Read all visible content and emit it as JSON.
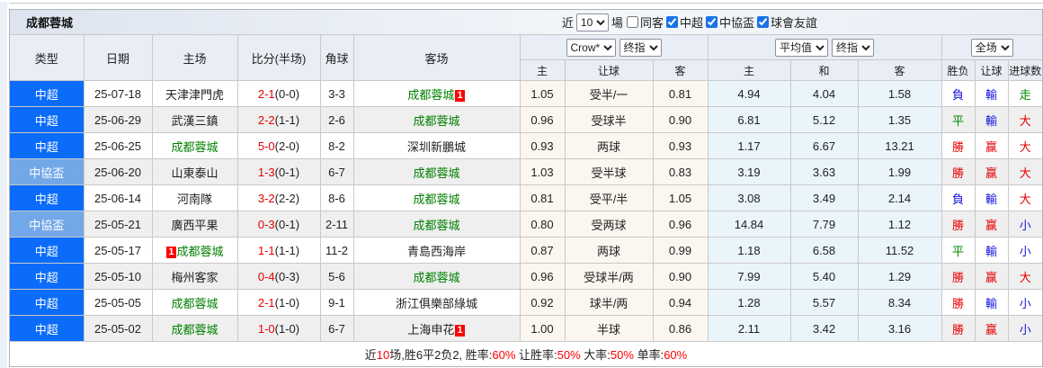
{
  "colors": {
    "league_type": {
      "中超": "#0b6cfa",
      "中協盃": "#73a8e8"
    },
    "result": {
      "勝": "#e60000",
      "赢": "#e60000",
      "大": "#e60000",
      "平": "#008800",
      "走": "#008800",
      "負": "#1515dd",
      "輸": "#1515dd",
      "小": "#1515dd"
    },
    "self_team": "#008000",
    "score": "#e60000",
    "badge_bg": "#ff0000",
    "stat_red": "#ff0000"
  },
  "toolbar": {
    "title": "成都蓉城",
    "recent_prefix": "近",
    "recent_value": "10",
    "recent_suffix": "場",
    "filters": [
      {
        "label": "同客",
        "checked": false
      },
      {
        "label": "中超",
        "checked": true
      },
      {
        "label": "中協盃",
        "checked": true
      },
      {
        "label": "球會友誼",
        "checked": true
      }
    ]
  },
  "columns": {
    "type": "类型",
    "date": "日期",
    "home": "主场",
    "score": "比分(半场)",
    "corner": "角球",
    "away": "客场",
    "sub": [
      "主",
      "让球",
      "客",
      "主",
      "和",
      "客",
      "胜负",
      "让球",
      "进球数"
    ]
  },
  "selects": {
    "asian_source": "Crow*",
    "asian_time": "终指",
    "euro_source": "平均值",
    "euro_time": "终指",
    "scope": "全场"
  },
  "rows": [
    {
      "type": "中超",
      "date": "25-07-18",
      "home": {
        "name": "天津津門虎",
        "self": false,
        "badge": ""
      },
      "away": {
        "name": "成都蓉城",
        "self": true,
        "badge": "1",
        "badge_side": "right"
      },
      "ft": "2-1",
      "ht": "(0-0)",
      "corner": "3-3",
      "hcap_home": "1.05",
      "hcap_line": "受半/一",
      "hcap_away": "0.81",
      "avg_home": "4.94",
      "avg_draw": "4.04",
      "avg_away": "1.58",
      "res_wdl": "負",
      "res_hcap": "輸",
      "res_goal": "走"
    },
    {
      "type": "中超",
      "date": "25-06-29",
      "home": {
        "name": "武漢三鎮",
        "self": false,
        "badge": ""
      },
      "away": {
        "name": "成都蓉城",
        "self": true,
        "badge": ""
      },
      "ft": "2-2",
      "ht": "(1-1)",
      "corner": "2-6",
      "hcap_home": "0.96",
      "hcap_line": "受球半",
      "hcap_away": "0.90",
      "avg_home": "6.81",
      "avg_draw": "5.12",
      "avg_away": "1.35",
      "res_wdl": "平",
      "res_hcap": "輸",
      "res_goal": "大"
    },
    {
      "type": "中超",
      "date": "25-06-25",
      "home": {
        "name": "成都蓉城",
        "self": true,
        "badge": ""
      },
      "away": {
        "name": "深圳新鵬城",
        "self": false,
        "badge": ""
      },
      "ft": "5-0",
      "ht": "(2-0)",
      "corner": "8-2",
      "hcap_home": "0.93",
      "hcap_line": "两球",
      "hcap_away": "0.93",
      "avg_home": "1.17",
      "avg_draw": "6.67",
      "avg_away": "13.21",
      "res_wdl": "勝",
      "res_hcap": "赢",
      "res_goal": "大"
    },
    {
      "type": "中協盃",
      "date": "25-06-20",
      "home": {
        "name": "山東泰山",
        "self": false,
        "badge": ""
      },
      "away": {
        "name": "成都蓉城",
        "self": true,
        "badge": ""
      },
      "ft": "1-3",
      "ht": "(0-1)",
      "corner": "6-7",
      "hcap_home": "1.03",
      "hcap_line": "受半球",
      "hcap_away": "0.83",
      "avg_home": "3.19",
      "avg_draw": "3.63",
      "avg_away": "1.99",
      "res_wdl": "勝",
      "res_hcap": "赢",
      "res_goal": "大"
    },
    {
      "type": "中超",
      "date": "25-06-14",
      "home": {
        "name": "河南隊",
        "self": false,
        "badge": ""
      },
      "away": {
        "name": "成都蓉城",
        "self": true,
        "badge": ""
      },
      "ft": "3-2",
      "ht": "(2-2)",
      "corner": "8-6",
      "hcap_home": "0.81",
      "hcap_line": "受平/半",
      "hcap_away": "1.05",
      "avg_home": "3.08",
      "avg_draw": "3.49",
      "avg_away": "2.14",
      "res_wdl": "負",
      "res_hcap": "輸",
      "res_goal": "大"
    },
    {
      "type": "中協盃",
      "date": "25-05-21",
      "home": {
        "name": "廣西平果",
        "self": false,
        "badge": ""
      },
      "away": {
        "name": "成都蓉城",
        "self": true,
        "badge": ""
      },
      "ft": "0-3",
      "ht": "(0-1)",
      "corner": "2-11",
      "hcap_home": "0.80",
      "hcap_line": "受两球",
      "hcap_away": "0.96",
      "avg_home": "14.84",
      "avg_draw": "7.79",
      "avg_away": "1.12",
      "res_wdl": "勝",
      "res_hcap": "赢",
      "res_goal": "小"
    },
    {
      "type": "中超",
      "date": "25-05-17",
      "home": {
        "name": "成都蓉城",
        "self": true,
        "badge": "1",
        "badge_side": "left"
      },
      "away": {
        "name": "青島西海岸",
        "self": false,
        "badge": ""
      },
      "ft": "1-1",
      "ht": "(1-1)",
      "corner": "11-2",
      "hcap_home": "0.87",
      "hcap_line": "两球",
      "hcap_away": "0.99",
      "avg_home": "1.18",
      "avg_draw": "6.58",
      "avg_away": "11.52",
      "res_wdl": "平",
      "res_hcap": "輸",
      "res_goal": "小"
    },
    {
      "type": "中超",
      "date": "25-05-10",
      "home": {
        "name": "梅州客家",
        "self": false,
        "badge": ""
      },
      "away": {
        "name": "成都蓉城",
        "self": true,
        "badge": ""
      },
      "ft": "0-4",
      "ht": "(0-3)",
      "corner": "5-6",
      "hcap_home": "0.96",
      "hcap_line": "受球半/两",
      "hcap_away": "0.90",
      "avg_home": "7.99",
      "avg_draw": "5.40",
      "avg_away": "1.29",
      "res_wdl": "勝",
      "res_hcap": "赢",
      "res_goal": "大"
    },
    {
      "type": "中超",
      "date": "25-05-05",
      "home": {
        "name": "成都蓉城",
        "self": true,
        "badge": ""
      },
      "away": {
        "name": "浙江俱樂部綠城",
        "self": false,
        "badge": ""
      },
      "ft": "2-1",
      "ht": "(1-0)",
      "corner": "9-1",
      "hcap_home": "0.92",
      "hcap_line": "球半/两",
      "hcap_away": "0.94",
      "avg_home": "1.28",
      "avg_draw": "5.57",
      "avg_away": "8.34",
      "res_wdl": "勝",
      "res_hcap": "輸",
      "res_goal": "小"
    },
    {
      "type": "中超",
      "date": "25-05-02",
      "home": {
        "name": "成都蓉城",
        "self": true,
        "badge": ""
      },
      "away": {
        "name": "上海申花",
        "self": false,
        "badge": "1",
        "badge_side": "right"
      },
      "ft": "1-0",
      "ht": "(1-0)",
      "corner": "6-7",
      "hcap_home": "1.00",
      "hcap_line": "半球",
      "hcap_away": "0.86",
      "avg_home": "2.11",
      "avg_draw": "3.42",
      "avg_away": "3.16",
      "res_wdl": "勝",
      "res_hcap": "赢",
      "res_goal": "小"
    }
  ],
  "footer": {
    "segments": [
      {
        "text": "近"
      },
      {
        "text": "10",
        "red": true
      },
      {
        "text": "场,胜6平2负2, 胜率:"
      },
      {
        "text": "60%",
        "red": true
      },
      {
        "text": " 让胜率:"
      },
      {
        "text": "50%",
        "red": true
      },
      {
        "text": " 大率:"
      },
      {
        "text": "50%",
        "red": true
      },
      {
        "text": " 单率:"
      },
      {
        "text": "60%",
        "red": true
      }
    ]
  }
}
